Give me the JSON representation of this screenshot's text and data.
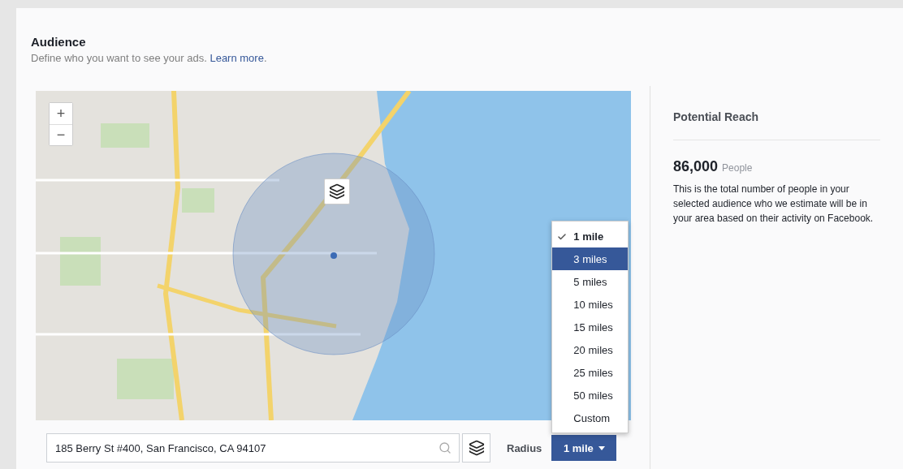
{
  "section": {
    "title": "Audience",
    "description": "Define who you want to see your ads.",
    "link": "Learn more",
    "description_end": "."
  },
  "map": {
    "zoom_in": "+",
    "zoom_out": "−"
  },
  "location": {
    "value": "185 Berry St #400, San Francisco, CA 94107"
  },
  "radius": {
    "label": "Radius",
    "value": "1 mile",
    "expanded": true,
    "options": [
      {
        "label": "1 mile",
        "selected": true,
        "hovered": false
      },
      {
        "label": "3 miles",
        "selected": false,
        "hovered": true
      },
      {
        "label": "5 miles",
        "selected": false,
        "hovered": false
      },
      {
        "label": "10 miles",
        "selected": false,
        "hovered": false
      },
      {
        "label": "15 miles",
        "selected": false,
        "hovered": false
      },
      {
        "label": "20 miles",
        "selected": false,
        "hovered": false
      },
      {
        "label": "25 miles",
        "selected": false,
        "hovered": false
      },
      {
        "label": "50 miles",
        "selected": false,
        "hovered": false
      },
      {
        "label": "Custom",
        "selected": false,
        "hovered": false
      }
    ]
  },
  "reach": {
    "title": "Potential Reach",
    "count": "86,000",
    "unit": "People",
    "description": "This is the total number of people in your selected audience who we estimate will be in your area based on their activity on Facebook."
  }
}
